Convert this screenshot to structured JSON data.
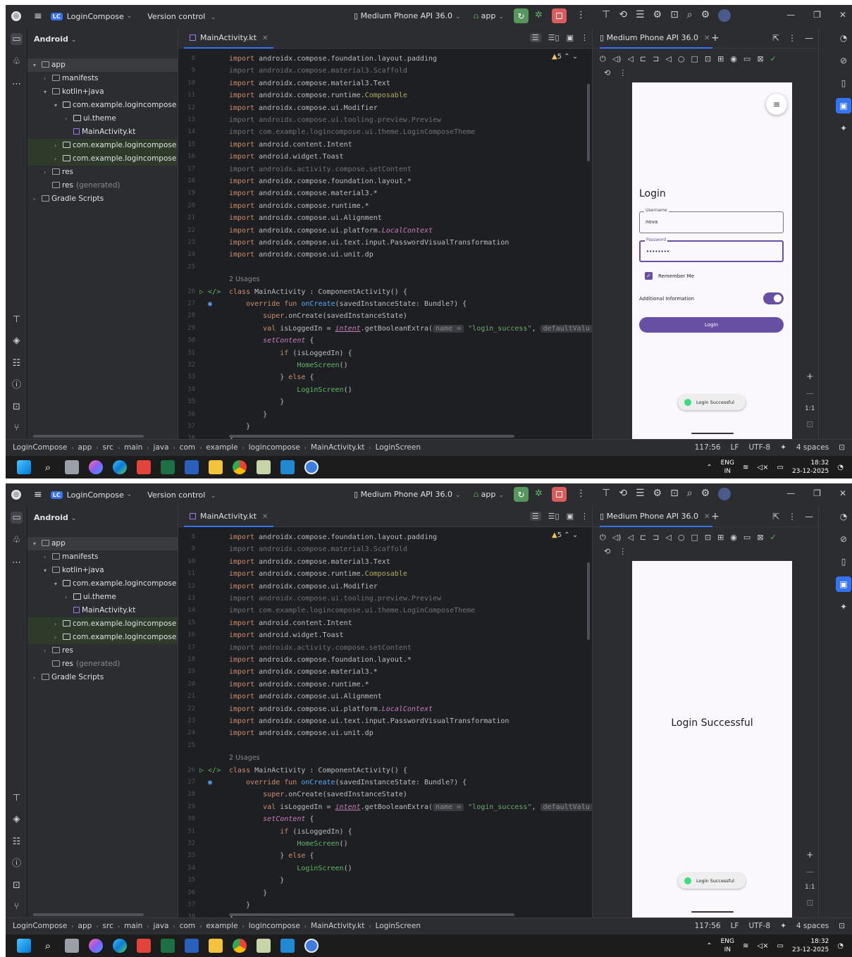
{
  "shots": [
    {
      "titlebar": {
        "project": "LoginCompose",
        "badge": "LC",
        "vcs": "Version control",
        "device": "Medium Phone API 36.0",
        "app": "app"
      },
      "project_panel": {
        "header": "Android"
      },
      "editor": {
        "tab": "MainActivity.kt",
        "warnings": "5"
      },
      "running": {
        "tab": "Medium Phone API 36.0"
      },
      "phone": {
        "screen": "login",
        "title": "Login",
        "username_label": "Username",
        "username_value": "nova",
        "password_label": "Password",
        "password_value": "••••••••",
        "remember_label": "Remember Me",
        "remember_checked": true,
        "additional_label": "Additional Information",
        "additional_on": true,
        "login_button": "Login",
        "toast": "Login Successful",
        "message": ""
      },
      "zoom_ratio": "1:1",
      "status": {
        "position": "117:56",
        "line_ending": "LF",
        "encoding": "UTF-8",
        "indent": "4 spaces"
      },
      "taskbar": {
        "lang1": "ENG",
        "lang2": "IN",
        "time": "18:32",
        "date": "23-12-2025"
      }
    },
    {
      "titlebar": {
        "project": "LoginCompose",
        "badge": "LC",
        "vcs": "Version control",
        "device": "Medium Phone API 36.0",
        "app": "app"
      },
      "project_panel": {
        "header": "Android"
      },
      "editor": {
        "tab": "MainActivity.kt",
        "warnings": "5"
      },
      "running": {
        "tab": "Medium Phone API 36.0"
      },
      "phone": {
        "screen": "home",
        "title": "",
        "username_label": "",
        "username_value": "",
        "password_label": "",
        "password_value": "",
        "remember_label": "",
        "remember_checked": false,
        "additional_label": "",
        "additional_on": false,
        "login_button": "",
        "toast": "Login Successful",
        "message": "Login Successful"
      },
      "zoom_ratio": "1:1",
      "status": {
        "position": "117:56",
        "line_ending": "LF",
        "encoding": "UTF-8",
        "indent": "4 spaces"
      },
      "taskbar": {
        "lang1": "ENG",
        "lang2": "IN",
        "time": "18:32",
        "date": "23-12-2025"
      }
    }
  ],
  "tree": [
    {
      "label": "app",
      "suffix": "",
      "depth": 0,
      "arrow": "down",
      "icon": "module",
      "selected": true,
      "highlighted": false
    },
    {
      "label": "manifests",
      "suffix": "",
      "depth": 1,
      "arrow": "right",
      "icon": "folder",
      "selected": false,
      "highlighted": false
    },
    {
      "label": "kotlin+java",
      "suffix": "",
      "depth": 1,
      "arrow": "down",
      "icon": "folder",
      "selected": false,
      "highlighted": false
    },
    {
      "label": "com.example.logincompose",
      "suffix": "",
      "depth": 2,
      "arrow": "down",
      "icon": "package",
      "selected": false,
      "highlighted": false
    },
    {
      "label": "ui.theme",
      "suffix": "",
      "depth": 3,
      "arrow": "right",
      "icon": "package",
      "selected": false,
      "highlighted": false
    },
    {
      "label": "MainActivity.kt",
      "suffix": "",
      "depth": 3,
      "arrow": "none",
      "icon": "kotlin",
      "selected": false,
      "highlighted": false
    },
    {
      "label": "com.example.logincompose",
      "suffix": "(",
      "depth": 2,
      "arrow": "right",
      "icon": "package",
      "selected": false,
      "highlighted": true
    },
    {
      "label": "com.example.logincompose",
      "suffix": "(",
      "depth": 2,
      "arrow": "right",
      "icon": "package",
      "selected": false,
      "highlighted": true
    },
    {
      "label": "res",
      "suffix": "",
      "depth": 1,
      "arrow": "right",
      "icon": "folder",
      "selected": false,
      "highlighted": false
    },
    {
      "label": "res",
      "suffix": "(generated)",
      "depth": 1,
      "arrow": "none",
      "icon": "folder",
      "selected": false,
      "highlighted": false
    },
    {
      "label": "Gradle Scripts",
      "suffix": "",
      "depth": 0,
      "arrow": "right",
      "icon": "gradle",
      "selected": false,
      "highlighted": false
    }
  ],
  "code_lines": [
    {
      "n": "8",
      "gutter": "",
      "parts": [
        {
          "t": "import ",
          "c": "kw"
        },
        {
          "t": "androidx.compose.foundation.layout.padding",
          "c": ""
        }
      ]
    },
    {
      "n": "9",
      "gutter": "",
      "parts": [
        {
          "t": "import androidx.compose.material3.Scaffold",
          "c": "dim"
        }
      ]
    },
    {
      "n": "10",
      "gutter": "",
      "parts": [
        {
          "t": "import ",
          "c": "kw"
        },
        {
          "t": "androidx.compose.material3.Text",
          "c": ""
        }
      ]
    },
    {
      "n": "11",
      "gutter": "",
      "parts": [
        {
          "t": "import ",
          "c": "kw"
        },
        {
          "t": "androidx.compose.runtime.",
          "c": ""
        },
        {
          "t": "Composable",
          "c": "ann"
        }
      ]
    },
    {
      "n": "12",
      "gutter": "",
      "parts": [
        {
          "t": "import ",
          "c": "kw"
        },
        {
          "t": "androidx.compose.ui.Modifier",
          "c": ""
        }
      ]
    },
    {
      "n": "13",
      "gutter": "",
      "parts": [
        {
          "t": "import androidx.compose.ui.tooling.preview.Preview",
          "c": "dim"
        }
      ]
    },
    {
      "n": "14",
      "gutter": "",
      "parts": [
        {
          "t": "import com.example.logincompose.ui.theme.LoginComposeTheme",
          "c": "dim"
        }
      ]
    },
    {
      "n": "15",
      "gutter": "",
      "parts": [
        {
          "t": "import ",
          "c": "kw"
        },
        {
          "t": "android.content.Intent",
          "c": ""
        }
      ]
    },
    {
      "n": "16",
      "gutter": "",
      "parts": [
        {
          "t": "import ",
          "c": "kw"
        },
        {
          "t": "android.widget.Toast",
          "c": ""
        }
      ]
    },
    {
      "n": "17",
      "gutter": "",
      "parts": [
        {
          "t": "import androidx.activity.compose.setContent",
          "c": "dim"
        }
      ]
    },
    {
      "n": "18",
      "gutter": "",
      "parts": [
        {
          "t": "import ",
          "c": "kw"
        },
        {
          "t": "androidx.compose.foundation.layout.*",
          "c": ""
        }
      ]
    },
    {
      "n": "19",
      "gutter": "",
      "parts": [
        {
          "t": "import ",
          "c": "kw"
        },
        {
          "t": "androidx.compose.material3.*",
          "c": ""
        }
      ]
    },
    {
      "n": "20",
      "gutter": "",
      "parts": [
        {
          "t": "import ",
          "c": "kw"
        },
        {
          "t": "androidx.compose.runtime.*",
          "c": ""
        }
      ]
    },
    {
      "n": "21",
      "gutter": "",
      "parts": [
        {
          "t": "import ",
          "c": "kw"
        },
        {
          "t": "androidx.compose.ui.Alignment",
          "c": ""
        }
      ]
    },
    {
      "n": "22",
      "gutter": "",
      "parts": [
        {
          "t": "import ",
          "c": "kw"
        },
        {
          "t": "androidx.compose.ui.platform.",
          "c": ""
        },
        {
          "t": "LocalContext",
          "c": "itl"
        }
      ]
    },
    {
      "n": "23",
      "gutter": "",
      "parts": [
        {
          "t": "import ",
          "c": "kw"
        },
        {
          "t": "androidx.compose.ui.text.input.PasswordVisualTransformation",
          "c": ""
        }
      ]
    },
    {
      "n": "24",
      "gutter": "",
      "parts": [
        {
          "t": "import ",
          "c": "kw"
        },
        {
          "t": "androidx.compose.ui.unit.dp",
          "c": ""
        }
      ]
    },
    {
      "n": "25",
      "gutter": "",
      "parts": []
    },
    {
      "n": "",
      "gutter": "",
      "parts": [
        {
          "t": "2 Usages",
          "c": "usages"
        }
      ]
    },
    {
      "n": "26",
      "gutter": "▷ </>",
      "parts": [
        {
          "t": "class ",
          "c": "kw"
        },
        {
          "t": "MainActivity : ComponentActivity() {",
          "c": ""
        }
      ]
    },
    {
      "n": "27",
      "gutter": "  ◉",
      "parts": [
        {
          "t": "    override fun ",
          "c": "kw"
        },
        {
          "t": "onCreate",
          "c": "fn"
        },
        {
          "t": "(savedInstanceState: Bundle?) {",
          "c": ""
        }
      ]
    },
    {
      "n": "28",
      "gutter": "",
      "parts": [
        {
          "t": "        super",
          "c": "kw"
        },
        {
          "t": ".onCreate(savedInstanceState)",
          "c": ""
        }
      ]
    },
    {
      "n": "29",
      "gutter": "",
      "parts": [
        {
          "t": "        val ",
          "c": "kw"
        },
        {
          "t": "isLoggedIn = ",
          "c": ""
        },
        {
          "t": "intent",
          "c": "itl und"
        },
        {
          "t": ".getBooleanExtra(",
          "c": ""
        },
        {
          "t": "name =",
          "c": "hint"
        },
        {
          "t": " \"login_success\"",
          "c": "str"
        },
        {
          "t": ", ",
          "c": ""
        },
        {
          "t": "defaultValu",
          "c": "hint"
        }
      ]
    },
    {
      "n": "30",
      "gutter": "",
      "parts": [
        {
          "t": "        setContent",
          "c": "fn itl"
        },
        {
          "t": " {",
          "c": ""
        }
      ]
    },
    {
      "n": "31",
      "gutter": "",
      "parts": [
        {
          "t": "            if ",
          "c": "kw"
        },
        {
          "t": "(isLoggedIn) {",
          "c": ""
        }
      ]
    },
    {
      "n": "32",
      "gutter": "",
      "parts": [
        {
          "t": "                HomeScreen",
          "c": "green"
        },
        {
          "t": "()",
          "c": ""
        }
      ]
    },
    {
      "n": "33",
      "gutter": "",
      "parts": [
        {
          "t": "            } ",
          "c": ""
        },
        {
          "t": "else",
          "c": "kw"
        },
        {
          "t": " {",
          "c": ""
        }
      ]
    },
    {
      "n": "34",
      "gutter": "",
      "parts": [
        {
          "t": "                LoginScreen",
          "c": "green"
        },
        {
          "t": "()",
          "c": ""
        }
      ]
    },
    {
      "n": "35",
      "gutter": "",
      "parts": [
        {
          "t": "            }",
          "c": ""
        }
      ]
    },
    {
      "n": "36",
      "gutter": "",
      "parts": [
        {
          "t": "        }",
          "c": ""
        }
      ]
    },
    {
      "n": "37",
      "gutter": "",
      "parts": [
        {
          "t": "    }",
          "c": ""
        }
      ]
    },
    {
      "n": "38",
      "gutter": "",
      "parts": [
        {
          "t": "}",
          "c": ""
        }
      ]
    }
  ],
  "breadcrumbs": [
    "LoginCompose",
    "app",
    "src",
    "main",
    "java",
    "com",
    "example",
    "logincompose",
    "MainActivity.kt",
    "LoginScreen"
  ],
  "colors": {
    "accent": "#3574f0",
    "run": "#57965c",
    "stop": "#db5c5c",
    "compose_primary": "#6750a4",
    "toast_icon": "#3ddc84"
  }
}
